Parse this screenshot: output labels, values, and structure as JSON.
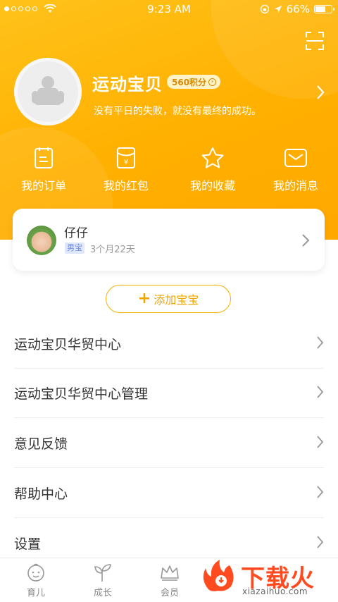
{
  "status_bar": {
    "time": "9:23 AM",
    "battery": "66%"
  },
  "profile": {
    "name": "运动宝贝",
    "points": "560积分",
    "motto": "没有平日的失败，就没有最终的成功。"
  },
  "quick_actions": [
    {
      "label": "我的订单",
      "icon": "order-icon"
    },
    {
      "label": "我的红包",
      "icon": "red-packet-icon"
    },
    {
      "label": "我的收藏",
      "icon": "star-icon"
    },
    {
      "label": "我的消息",
      "icon": "mail-icon"
    }
  ],
  "baby": {
    "name": "仔仔",
    "gender": "男宝",
    "age": "3个月22天"
  },
  "add_baby_label": "添加宝宝",
  "menu": [
    {
      "label": "运动宝贝华贸中心"
    },
    {
      "label": "运动宝贝华贸中心管理"
    },
    {
      "label": "意见反馈"
    },
    {
      "label": "帮助中心"
    },
    {
      "label": "设置"
    }
  ],
  "tabs": [
    {
      "label": "育儿",
      "icon": "baby-face-icon"
    },
    {
      "label": "成长",
      "icon": "sprout-icon"
    },
    {
      "label": "会员",
      "icon": "crown-icon"
    }
  ],
  "watermark": {
    "text": "下载火",
    "url": "xiazaihuo.com"
  },
  "colors": {
    "primary": "#ffb000",
    "accent_text": "#f0a500",
    "watermark": "#ff4b1f"
  }
}
